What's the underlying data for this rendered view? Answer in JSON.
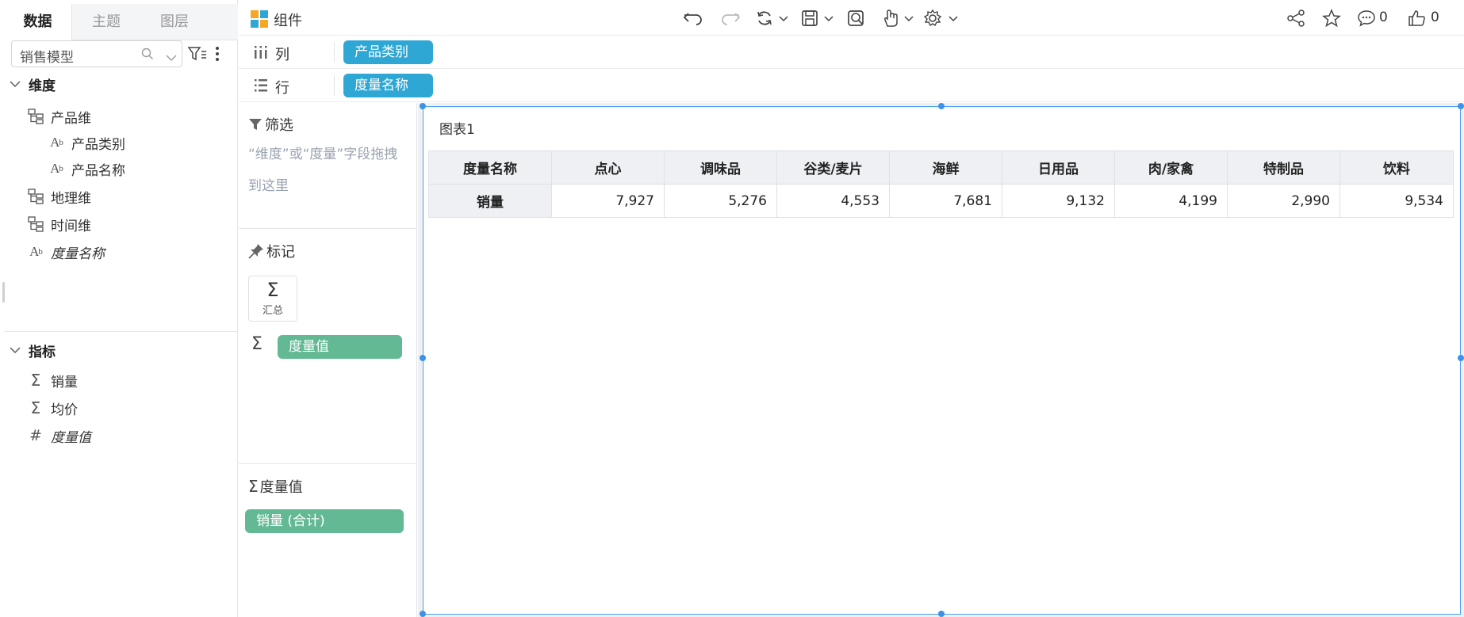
{
  "left_panel": {
    "tabs": [
      {
        "label": "数据",
        "active": true
      },
      {
        "label": "主题",
        "active": false
      },
      {
        "label": "图层",
        "active": false
      }
    ],
    "model_select": {
      "value": "销售模型"
    },
    "dimensions": {
      "title": "维度",
      "items": [
        {
          "label": "产品维",
          "icon": "hierarchy-icon"
        },
        {
          "label": "产品类别",
          "icon": "text-field-icon"
        },
        {
          "label": "产品名称",
          "icon": "text-field-icon"
        },
        {
          "label": "地理维",
          "icon": "hierarchy-icon"
        },
        {
          "label": "时间维",
          "icon": "hierarchy-icon"
        },
        {
          "label": "度量名称",
          "icon": "text-field-icon"
        }
      ]
    },
    "measures": {
      "title": "指标",
      "items": [
        {
          "label": "销量",
          "icon": "sigma-icon"
        },
        {
          "label": "均价",
          "icon": "sigma-icon"
        },
        {
          "label": "度量值",
          "icon": "hash-icon"
        }
      ]
    }
  },
  "toolbar": {
    "component_label": "组件",
    "comment_count": "0",
    "like_count": "0",
    "brand_colors": [
      "#f5a623",
      "#2ea7d4",
      "#2ea7d4",
      "#f5a623"
    ]
  },
  "shelves": {
    "columns": {
      "label": "列",
      "pill": "产品类别"
    },
    "rows": {
      "label": "行",
      "pill": "度量名称"
    }
  },
  "marks_panel": {
    "filter": {
      "title": "筛选",
      "hint": "“维度”或“度量”字段拖拽到这里"
    },
    "marks": {
      "title": "标记",
      "summary_label": "汇总",
      "pill": "度量值"
    },
    "measure_values": {
      "title": "度量值",
      "pill": "销量 (合计)"
    }
  },
  "chart": {
    "title": "图表1",
    "accent": "#4aa3f0"
  },
  "chart_data": {
    "type": "table",
    "columns": [
      "度量名称",
      "点心",
      "调味品",
      "谷类/麦片",
      "海鲜",
      "日用品",
      "肉/家禽",
      "特制品",
      "饮料"
    ],
    "rows": [
      {
        "label": "销量",
        "values": [
          "7,927",
          "5,276",
          "4,553",
          "7,681",
          "9,132",
          "4,199",
          "2,990",
          "9,534"
        ]
      }
    ]
  }
}
